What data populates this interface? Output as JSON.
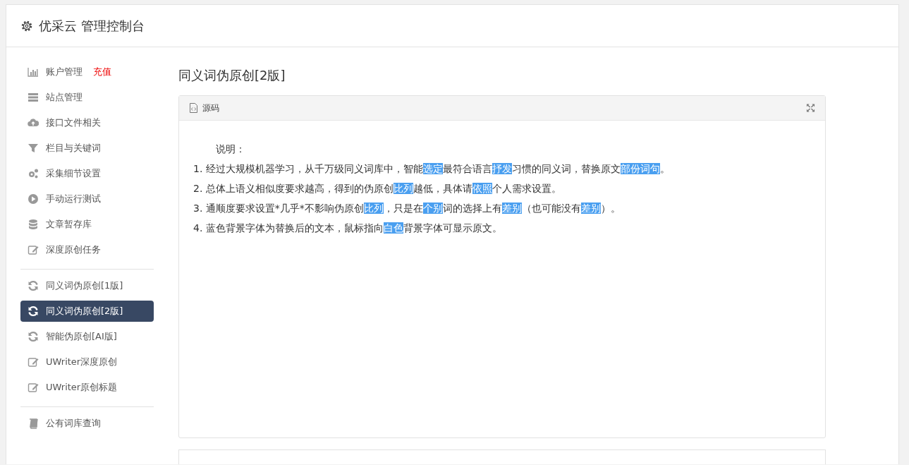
{
  "header": {
    "title": "优采云 管理控制台"
  },
  "sidebar": {
    "groups": [
      {
        "items": [
          {
            "label": "账户管理",
            "badge": "充值",
            "selected": false
          },
          {
            "label": "站点管理",
            "selected": false
          },
          {
            "label": "接口文件相关",
            "selected": false
          },
          {
            "label": "栏目与关键词",
            "selected": false
          },
          {
            "label": "采集细节设置",
            "selected": false
          },
          {
            "label": "手动运行测试",
            "selected": false
          },
          {
            "label": "文章暂存库",
            "selected": false
          },
          {
            "label": "深度原创任务",
            "selected": false
          }
        ]
      },
      {
        "items": [
          {
            "label": "同义词伪原创[1版]",
            "selected": false
          },
          {
            "label": "同义词伪原创[2版]",
            "selected": true
          },
          {
            "label": "智能伪原创[AI版]",
            "selected": false
          },
          {
            "label": "UWriter深度原创",
            "selected": false
          },
          {
            "label": "UWriter原创标题",
            "selected": false
          }
        ]
      },
      {
        "items": [
          {
            "label": "公有词库查询",
            "selected": false
          }
        ]
      }
    ]
  },
  "main": {
    "title": "同义词伪原创[2版]",
    "panel": {
      "title": "源码",
      "heading": "说明：",
      "lines": [
        {
          "segments": [
            {
              "text": "1. 经过大规模机器学习，从千万级同义词库中，智能",
              "replaced": false
            },
            {
              "text": "选定",
              "replaced": true
            },
            {
              "text": "最符合语言",
              "replaced": false
            },
            {
              "text": "抒发",
              "replaced": true
            },
            {
              "text": "习惯的同义词，替换原文",
              "replaced": false
            },
            {
              "text": "部份",
              "replaced": true
            },
            {
              "text": "词句",
              "replaced": true
            },
            {
              "text": "。",
              "replaced": false
            }
          ]
        },
        {
          "segments": [
            {
              "text": "2. 总体上语义相似度要求越高，得到的伪原创",
              "replaced": false
            },
            {
              "text": "比列",
              "replaced": true
            },
            {
              "text": "越低，具体请",
              "replaced": false
            },
            {
              "text": "依照",
              "replaced": true
            },
            {
              "text": "个人需求设置。",
              "replaced": false
            }
          ]
        },
        {
          "segments": [
            {
              "text": "3. 通顺度要求设置*几乎*不影响伪原创",
              "replaced": false
            },
            {
              "text": "比列",
              "replaced": true
            },
            {
              "text": "，只是在",
              "replaced": false
            },
            {
              "text": "个别",
              "replaced": true
            },
            {
              "text": "词的选择上有",
              "replaced": false
            },
            {
              "text": "差别",
              "replaced": true
            },
            {
              "text": "（也可能没有",
              "replaced": false
            },
            {
              "text": "差别",
              "replaced": true
            },
            {
              "text": "）。",
              "replaced": false
            }
          ]
        },
        {
          "segments": [
            {
              "text": "4. 蓝色背景字体为替换后的文本，鼠标指向",
              "replaced": false
            },
            {
              "text": "白色",
              "replaced": true
            },
            {
              "text": "背景字体可显示原文。",
              "replaced": false
            }
          ]
        }
      ]
    }
  }
}
